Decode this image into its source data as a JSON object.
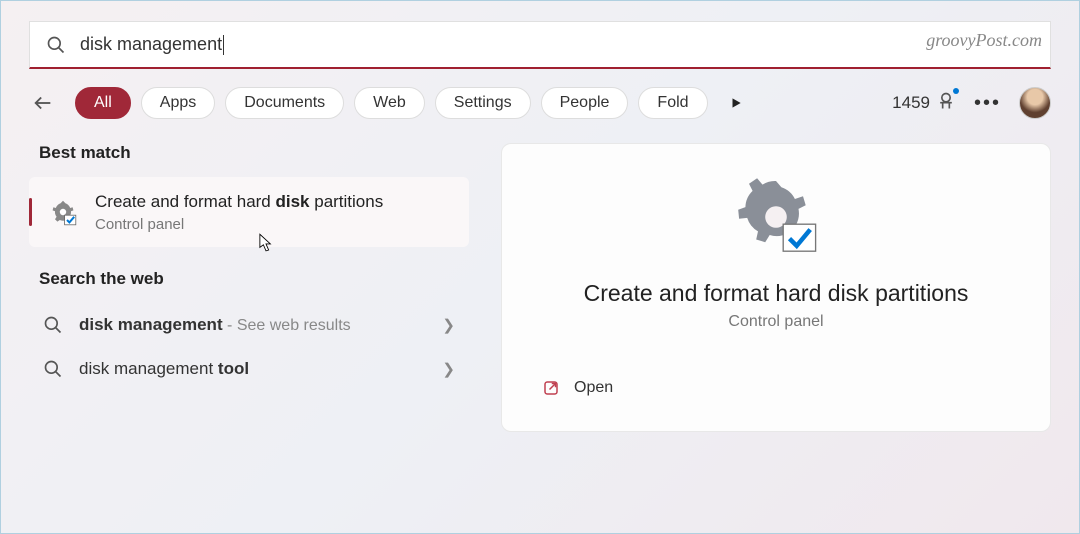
{
  "watermark": "groovyPost.com",
  "search": {
    "value": "disk management"
  },
  "filters": {
    "items": [
      "All",
      "Apps",
      "Documents",
      "Web",
      "Settings",
      "People",
      "Fold"
    ],
    "active_index": 0
  },
  "points": {
    "count": "1459"
  },
  "left": {
    "best_match_header": "Best match",
    "result": {
      "title_pre": "Create and format hard ",
      "title_bold": "disk",
      "title_post": " partitions",
      "sub": "Control panel",
      "icon": "disk-management-icon"
    },
    "web_header": "Search the web",
    "web_items": [
      {
        "text_pre": "",
        "text_bold": "disk management",
        "text_post": "",
        "hint": " - See web results"
      },
      {
        "text_pre": "disk management ",
        "text_bold": "tool",
        "text_post": "",
        "hint": ""
      }
    ]
  },
  "right": {
    "title": "Create and format hard disk partitions",
    "sub": "Control panel",
    "actions": [
      {
        "label": "Open",
        "icon": "open-external-icon"
      }
    ]
  }
}
